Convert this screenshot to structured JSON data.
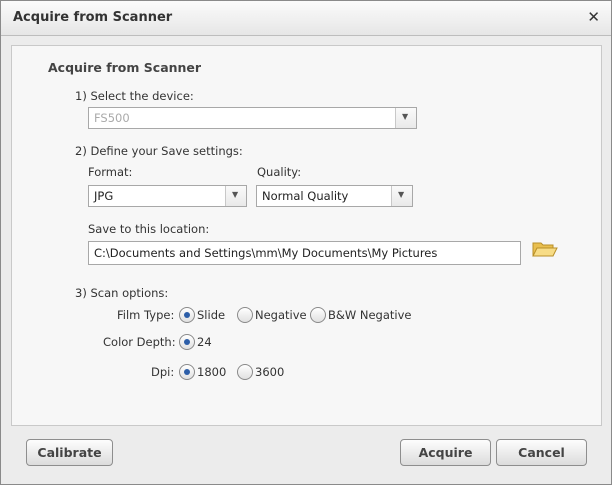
{
  "window": {
    "title": "Acquire from Scanner"
  },
  "content": {
    "heading": "Acquire from Scanner",
    "device": {
      "label": "1) Select the device:",
      "value": "FS500"
    },
    "save_settings": {
      "label": "2) Define your Save settings:",
      "format": {
        "label": "Format:",
        "value": "JPG"
      },
      "quality": {
        "label": "Quality:",
        "value": "Normal Quality"
      },
      "location": {
        "label": "Save to this location:",
        "value": "C:\\Documents and Settings\\mm\\My Documents\\My Pictures"
      }
    },
    "scan_options": {
      "label": "3) Scan options:",
      "film_type": {
        "label": "Film Type:",
        "options": [
          "Slide",
          "Negative",
          "B&W Negative"
        ],
        "selected": "Slide"
      },
      "color_depth": {
        "label": "Color Depth:",
        "options": [
          "24"
        ],
        "selected": "24"
      },
      "dpi": {
        "label": "Dpi:",
        "options": [
          "1800",
          "3600"
        ],
        "selected": "1800"
      }
    }
  },
  "buttons": {
    "calibrate": "Calibrate",
    "acquire": "Acquire",
    "cancel": "Cancel"
  },
  "icons": {
    "close": "close-icon",
    "folder": "folder-icon",
    "dropdown": "chevron-down-icon"
  },
  "colors": {
    "radio_selected": "#2c5ea8",
    "folder": "#f3cf6a"
  }
}
